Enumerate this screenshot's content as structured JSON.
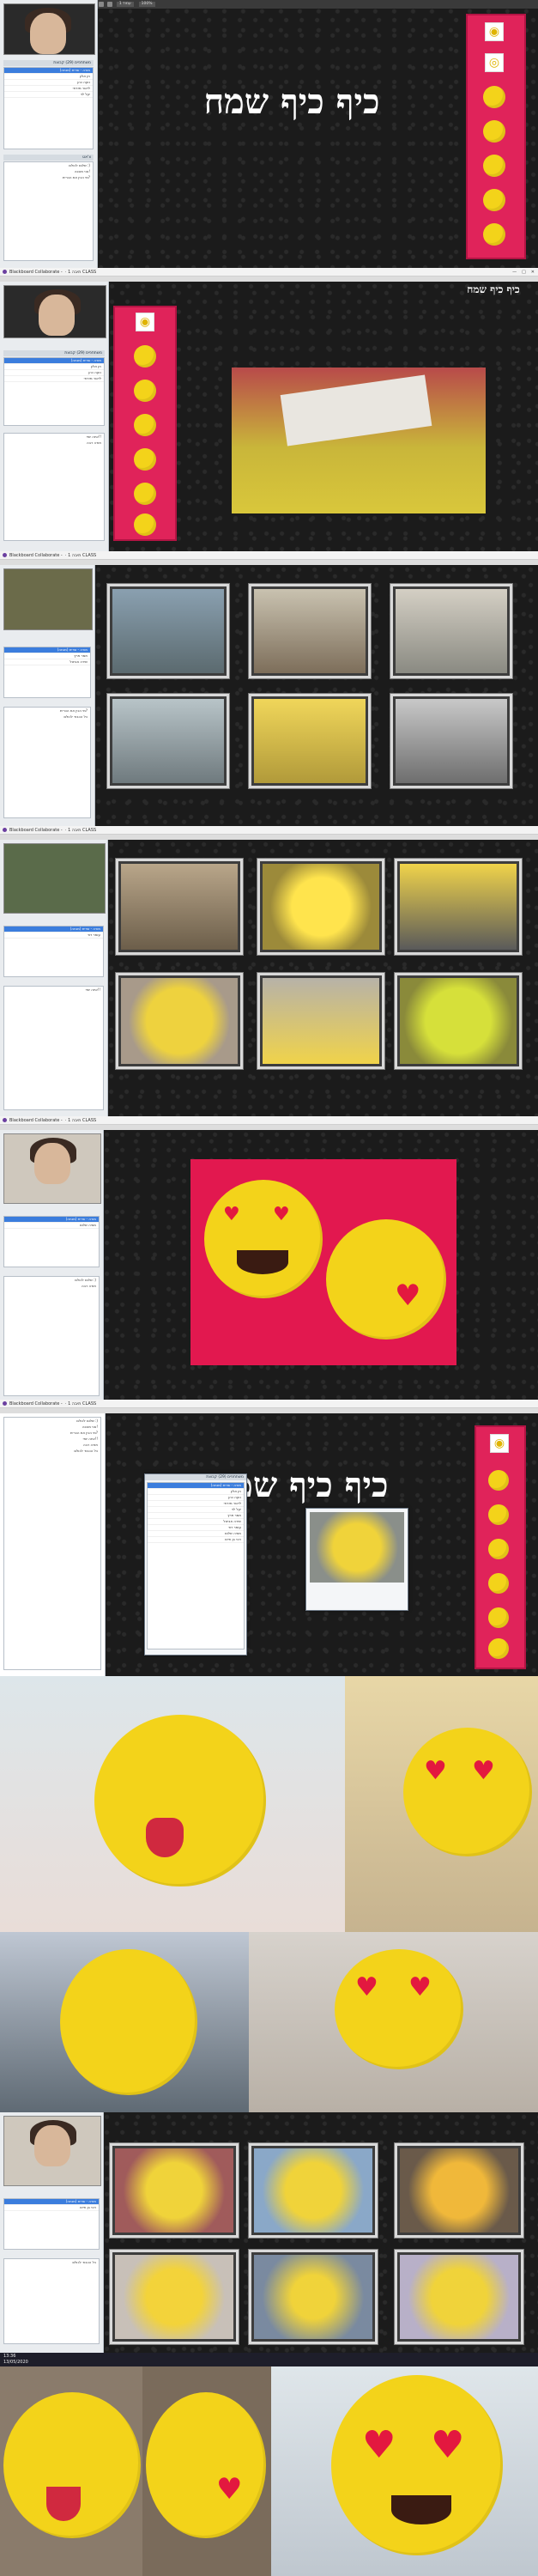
{
  "app": {
    "window_title": "Blackboard Collaborate - ‎ · תיבה 1 CLASS",
    "window_controls": [
      "—",
      "□",
      "✕"
    ]
  },
  "logo_text": "כיף כיף שמח",
  "panels": {
    "participants_header": "משתתפים (29) קבוצת",
    "chat_header": "צ'אט",
    "participants": [
      "מורה - שרית (מנחה)",
      "חן אלון",
      "נועה כהן",
      "ליאור מזרחי",
      "יעל לוי",
      "תמר פרץ",
      "שירה אביטל",
      "עומר דוד",
      "מאיה שלום",
      "רוני בן חיים"
    ],
    "chat_lines": [
      "שלום לכולם :)",
      "אני מוכנה!",
      "מי הכין את הכרית?",
      "איזה יופי!!",
      "תודה רבה",
      "כל הכבוד לכולם"
    ]
  },
  "toolbar": {
    "zoom_label": "100%",
    "page_label": "עמוד 1",
    "follow_label": "עקוב"
  },
  "taskbar": {
    "time": "13:36",
    "date": "13/05/2020"
  },
  "emoji_icons": [
    "heart-eyes",
    "kiss",
    "laughing",
    "tongue",
    "smile",
    "wink"
  ],
  "colors": {
    "board_bg": "#1b1b1b",
    "strip_red": "#e0235a",
    "emoji_yellow": "#f3d31a",
    "heart_red": "#e3183f",
    "selected_row": "#3b7ddd"
  }
}
